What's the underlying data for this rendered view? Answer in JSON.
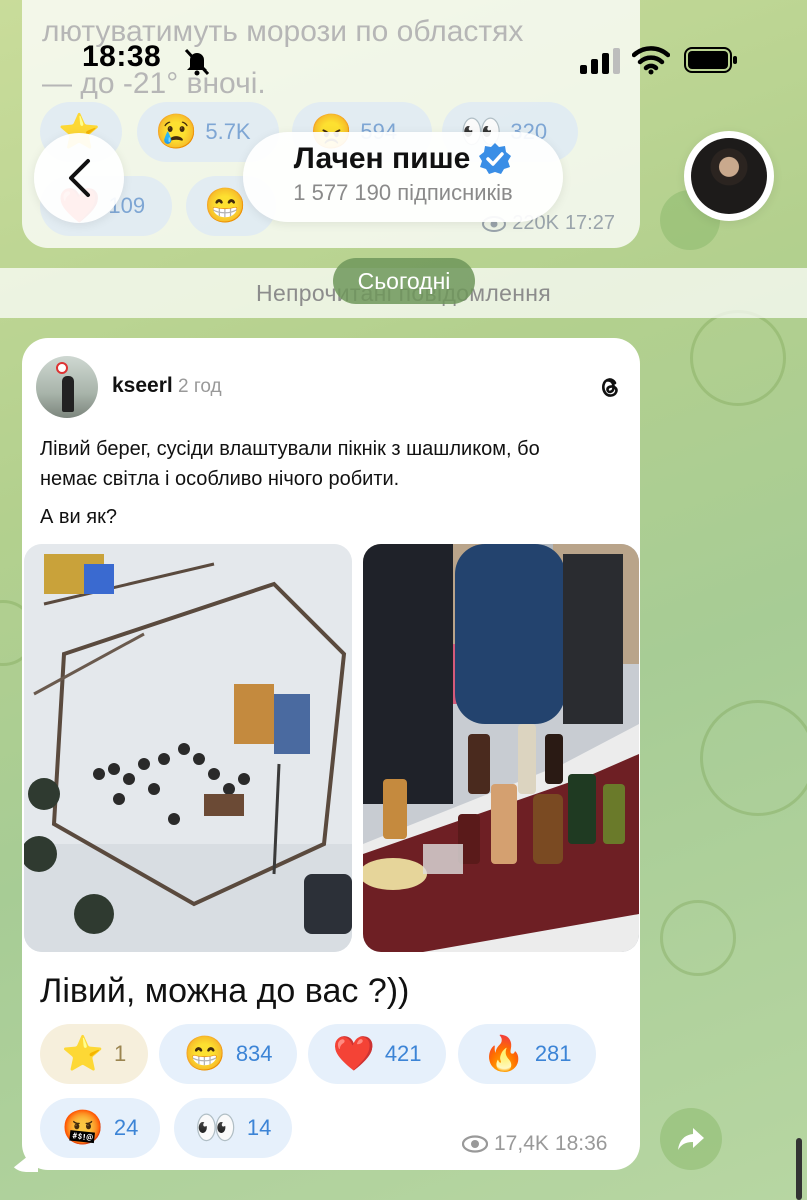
{
  "status_bar": {
    "time": "18:38"
  },
  "prev_message": {
    "text_line1": "лютуватимуть морози по областях",
    "text_line2": "— до -21° вночі.",
    "reactions": [
      {
        "icon": "star",
        "emoji": "⭐",
        "count": ""
      },
      {
        "icon": "crying-face",
        "emoji": "😢",
        "count": "5.7K"
      },
      {
        "icon": "angry-face",
        "emoji": "😠",
        "count": "594"
      },
      {
        "icon": "eyes",
        "emoji": "👀",
        "count": "320"
      },
      {
        "icon": "heart",
        "emoji": "❤️",
        "count": "109"
      },
      {
        "icon": "grinning-face",
        "emoji": "😁",
        "count": ""
      }
    ],
    "views": "220K",
    "time": "17:27"
  },
  "header": {
    "channel_name": "Лачен пише",
    "subscribers": "1 577 190 підписників"
  },
  "unread_label": "Непрочитані повідомлення",
  "date_pill": "Сьогодні",
  "post": {
    "author": "kseerl",
    "time_ago": "2 год",
    "text": "Лівий берег, сусіди влаштували пікнік з шашликом, бо немає світла і особливо нічого робити.",
    "question": "А ви як?",
    "caption": "Лівий, можна до вас ?))",
    "reactions": [
      {
        "icon": "star",
        "emoji": "⭐",
        "count": "1"
      },
      {
        "icon": "grinning-face",
        "emoji": "😁",
        "count": "834"
      },
      {
        "icon": "heart",
        "emoji": "❤️",
        "count": "421"
      },
      {
        "icon": "fire",
        "emoji": "🔥",
        "count": "281"
      },
      {
        "icon": "cursing-face",
        "emoji": "🤬",
        "count": "24"
      },
      {
        "icon": "eyes",
        "emoji": "👀",
        "count": "14"
      }
    ],
    "views": "17,4K",
    "time": "18:36"
  },
  "colors": {
    "accent": "#3c84d6",
    "verified": "#3a8ee6",
    "bubble": "#ffffff",
    "background": "#b3d08e"
  }
}
